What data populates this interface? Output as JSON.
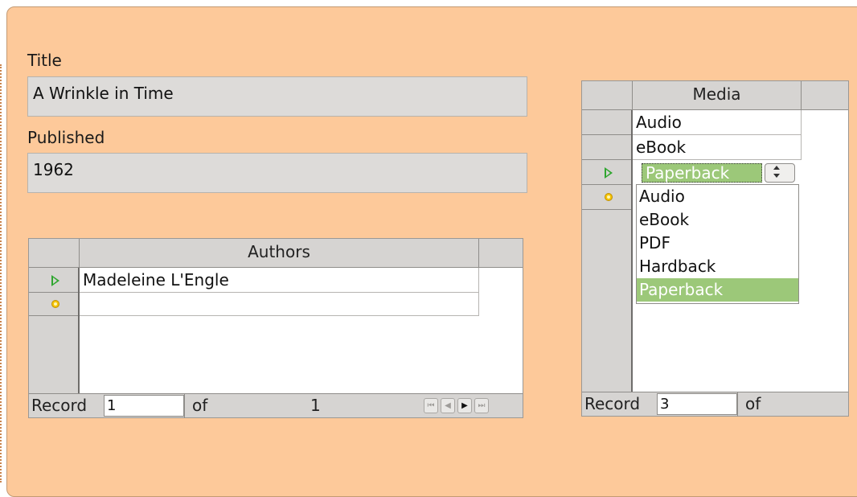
{
  "form": {
    "title_label": "Title",
    "title_value": "A Wrinkle in Time",
    "published_label": "Published",
    "published_value": "1962"
  },
  "authors_grid": {
    "header": "Authors",
    "rows": [
      "Madeleine L'Engle",
      ""
    ],
    "nav": {
      "record_label": "Record",
      "record_value": "1",
      "of_label": "of",
      "total": "1",
      "buttons": [
        "first-record",
        "previous-record",
        "next-record",
        "last-record"
      ]
    }
  },
  "media_grid": {
    "header": "Media",
    "rows": [
      "Audio",
      "eBook"
    ],
    "current_value": "Paperback",
    "dropdown_options": [
      "Audio",
      "eBook",
      "PDF",
      "Hardback",
      "Paperback"
    ],
    "selected_option": "Paperback",
    "nav": {
      "record_label": "Record",
      "record_value": "3",
      "of_label": "of"
    }
  },
  "colors": {
    "form_background": "#fdc99a",
    "selection_green": "#9cc879",
    "current_row_arrow": "#2fa62f",
    "new_row_marker": "#f6c400"
  },
  "icons": {
    "current_row": "current-row-arrow-icon",
    "new_row": "new-row-marker-icon"
  }
}
